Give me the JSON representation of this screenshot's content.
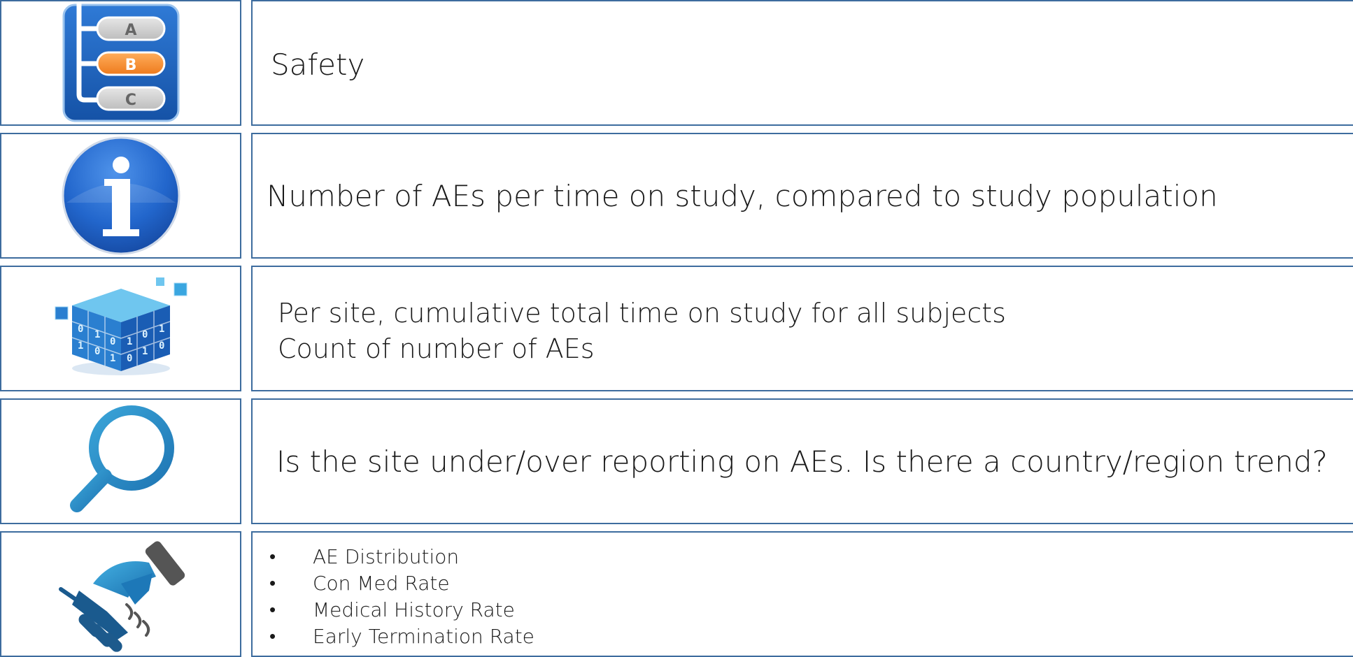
{
  "rows": [
    {
      "icon": "abc-list-icon",
      "text": "Safety"
    },
    {
      "icon": "info-icon",
      "text": "Number of AEs per time on study, compared to study population"
    },
    {
      "icon": "data-cube-icon",
      "lines": [
        "Per site, cumulative total time on study for all subjects",
        "Count of number of AEs"
      ]
    },
    {
      "icon": "magnifier-icon",
      "text": "Is the site under/over reporting on AEs. Is there a country/region trend?"
    },
    {
      "icon": "handshake-icon",
      "bullets": [
        "AE Distribution",
        "Con Med Rate",
        "Medical History Rate",
        "Early Termination Rate"
      ]
    }
  ],
  "icon_labels": {
    "a": "A",
    "b": "B",
    "c": "C"
  },
  "colors": {
    "border": "#3d6c9e",
    "icon_blue": "#1f62b8",
    "accent_orange": "#f28a2e",
    "magnifier_blue": "#2a8fc6"
  }
}
